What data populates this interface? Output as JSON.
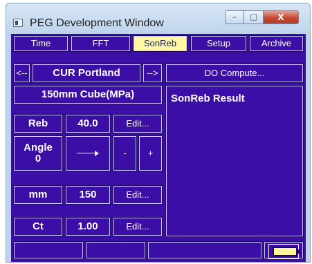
{
  "window": {
    "title": "PEG Development Window",
    "controls": {
      "minimize": "–",
      "maximize": "□",
      "close": "X"
    }
  },
  "tabs": [
    {
      "label": "Time",
      "active": false
    },
    {
      "label": "FFT",
      "active": false
    },
    {
      "label": "SonReb",
      "active": true
    },
    {
      "label": "Setup",
      "active": false
    },
    {
      "label": "Archive",
      "active": false
    }
  ],
  "navigator": {
    "prev_label": "<--",
    "current_label": "CUR Portland",
    "next_label": "-->"
  },
  "compute": {
    "button_label": "DO Compute..."
  },
  "specimen": {
    "label": "150mm Cube(MPa)"
  },
  "reb": {
    "label": "Reb",
    "value": "40.0",
    "edit_label": "Edit..."
  },
  "angle": {
    "label_line1": "Angle",
    "label_line2": "0",
    "minus_label": "-",
    "plus_label": "+",
    "arrow_icon": "arrow-right-icon"
  },
  "mm": {
    "label": "mm",
    "value": "150",
    "edit_label": "Edit..."
  },
  "ct": {
    "label": "Ct",
    "value": "1.00",
    "edit_label": "Edit..."
  },
  "result": {
    "title": "SonReb Result"
  },
  "status": {
    "battery_icon": "battery-icon",
    "battery_color": "#fff59a"
  },
  "colors": {
    "app_background": "#3b0fa5",
    "active_tab": "#fdf7a6",
    "border": "#c8ccff"
  }
}
